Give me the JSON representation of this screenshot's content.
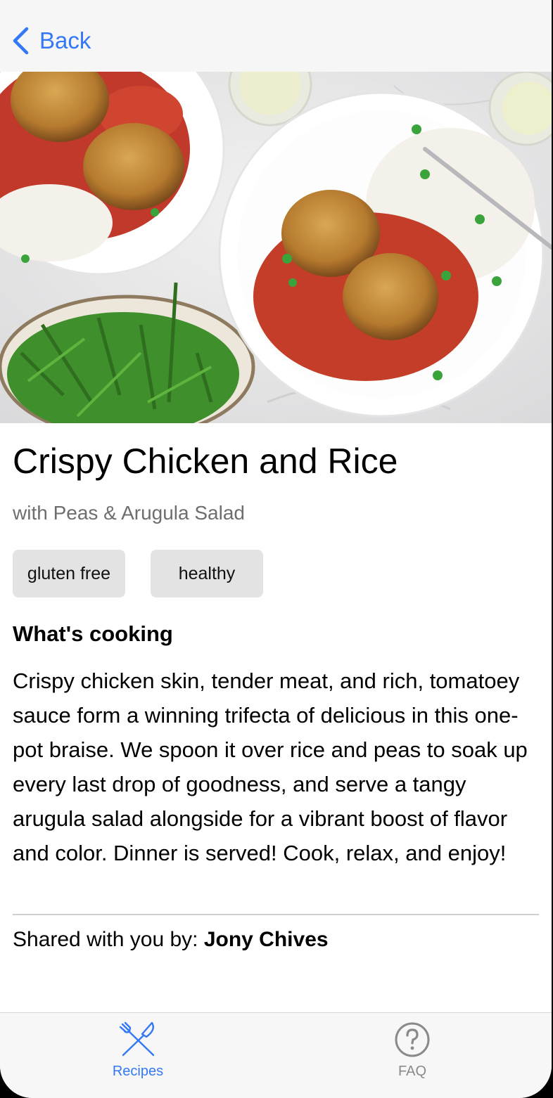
{
  "nav": {
    "back_label": "Back"
  },
  "recipe": {
    "title": "Crispy Chicken and Rice",
    "subtitle": "with Peas & Arugula Salad",
    "tags": [
      "gluten free",
      "healthy"
    ],
    "section_heading": "What's cooking",
    "description": "Crispy chicken skin, tender meat, and rich, tomatoey sauce form a winning trifecta of delicious in this one-pot braise. We spoon it over rice and peas to soak up every last drop of goodness, and serve a tangy arugula salad alongside for a vibrant boost of flavor and color. Dinner is served! Cook, relax, and enjoy!",
    "shared_prefix": "Shared with you by:",
    "shared_by": "Jony Chives"
  },
  "tabbar": {
    "tabs": [
      {
        "label": "Recipes",
        "icon": "fork-knife-icon",
        "selected": true
      },
      {
        "label": "FAQ",
        "icon": "question-circle-icon",
        "selected": false
      }
    ]
  },
  "colors": {
    "accent": "#3478f6",
    "tag_bg": "#e3e3e3",
    "inactive_tab": "#8a8a8a"
  }
}
